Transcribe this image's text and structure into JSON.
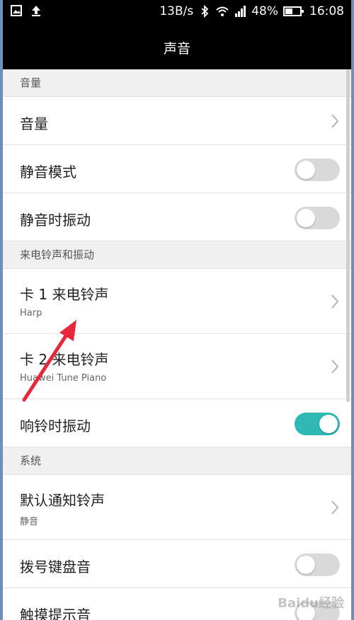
{
  "status_bar": {
    "speed": "13B/s",
    "battery": "48%",
    "time": "16:08",
    "icons": [
      "image-icon",
      "upload-icon",
      "bluetooth-icon",
      "wifi-icon",
      "signal-icon",
      "battery-icon"
    ]
  },
  "header": {
    "title": "声音"
  },
  "sections": [
    {
      "header": "音量",
      "rows": [
        {
          "title": "音量",
          "kind": "chevron"
        },
        {
          "title": "静音模式",
          "kind": "toggle",
          "on": false
        },
        {
          "title": "静音时振动",
          "kind": "toggle",
          "on": false
        }
      ]
    },
    {
      "header": "来电铃声和振动",
      "rows": [
        {
          "title": "卡 1 来电铃声",
          "subtitle": "Harp",
          "kind": "chevron"
        },
        {
          "title": "卡 2 来电铃声",
          "subtitle": "Huawei Tune Piano",
          "kind": "chevron"
        },
        {
          "title": "响铃时振动",
          "kind": "toggle",
          "on": true
        }
      ]
    },
    {
      "header": "系统",
      "rows": [
        {
          "title": "默认通知铃声",
          "subtitle": "静音",
          "kind": "chevron"
        },
        {
          "title": "拨号键盘音",
          "kind": "toggle",
          "on": false
        },
        {
          "title": "触摸提示音",
          "kind": "toggle",
          "on": false
        }
      ]
    }
  ],
  "colors": {
    "toggle_on": "#2fb8b4",
    "toggle_off": "#d9d9d9",
    "annotation_arrow": "#e8283a"
  },
  "watermark": "Baidu经验"
}
